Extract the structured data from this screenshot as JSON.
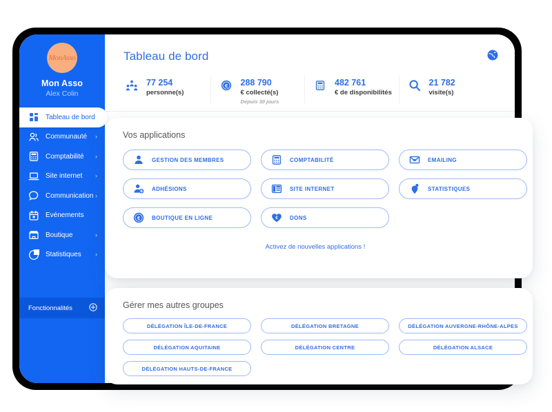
{
  "sidebar": {
    "brand_name": "Mon Asso",
    "brand_mark": "MonAsso",
    "user_name": "Alex Colin",
    "items": [
      {
        "label": "Tableau de bord",
        "icon": "dashboard-icon",
        "active": true,
        "caret": ""
      },
      {
        "label": "Communauté",
        "icon": "community-icon",
        "active": false,
        "caret": "›"
      },
      {
        "label": "Comptabilité",
        "icon": "calculator-icon",
        "active": false,
        "caret": "›"
      },
      {
        "label": "Site internet",
        "icon": "laptop-icon",
        "active": false,
        "caret": "›"
      },
      {
        "label": "Communication",
        "icon": "chat-icon",
        "active": false,
        "caret": "›"
      },
      {
        "label": "Evénements",
        "icon": "calendar-icon",
        "active": false,
        "caret": ""
      },
      {
        "label": "Boutique",
        "icon": "shop-icon",
        "active": false,
        "caret": "›"
      },
      {
        "label": "Statistiques",
        "icon": "chart-icon",
        "active": false,
        "caret": "›"
      }
    ],
    "features_label": "Fonctionnalités",
    "features_icon": "plus-circle-icon"
  },
  "header": {
    "title": "Tableau de bord",
    "globe_icon": "globe-icon",
    "stats": [
      {
        "value": "77 254",
        "label": "personne(s)",
        "sub": "",
        "icon": "people-icon"
      },
      {
        "value": "288 790",
        "label": "€ collecté(s)",
        "sub": "Depuis 30 jours",
        "icon": "euro-coin-icon"
      },
      {
        "value": "482 761",
        "label": "€ de disponibilités",
        "sub": "",
        "icon": "calculator-icon"
      },
      {
        "value": "21 782",
        "label": "visite(s)",
        "sub": "",
        "icon": "search-icon"
      }
    ]
  },
  "apps_card": {
    "title": "Vos applications",
    "apps": [
      {
        "label": "GESTION DES MEMBRES",
        "icon": "user-icon"
      },
      {
        "label": "COMPTABILITÉ",
        "icon": "calculator-icon"
      },
      {
        "label": "EMAILING",
        "icon": "envelope-icon"
      },
      {
        "label": "ADHÉSIONS",
        "icon": "user-plus-icon"
      },
      {
        "label": "SITE INTERNET",
        "icon": "layout-icon"
      },
      {
        "label": "STATISTIQUES",
        "icon": "chart-pin-icon"
      },
      {
        "label": "BOUTIQUE EN LIGNE",
        "icon": "euro-coin-icon"
      },
      {
        "label": "DONS",
        "icon": "heart-euro-icon"
      }
    ],
    "activate_link": "Activez de nouvelles applications !"
  },
  "groups_card": {
    "title": "Gérer mes autres groupes",
    "groups": [
      "DÉLÉGATION ÎLE-DE-FRANCE",
      "DÉLÉGATION BRETAGNE",
      "DÉLÉGATION AUVERGNE-RHÔNE-ALPES",
      "DÉLÉGATION AQUITAINE",
      "DÉLÉGATION CENTRE",
      "DÉLÉGATION ALSACE",
      "DÉLÉGATION HAUTS-DE-FRANCE"
    ]
  },
  "colors": {
    "sidebar_blue": "#1266f1",
    "accent_blue": "#2f6fe4",
    "outline_blue": "#9ab9f5",
    "avatar_peach": "#f9ae7f",
    "frame_black": "#000000"
  }
}
